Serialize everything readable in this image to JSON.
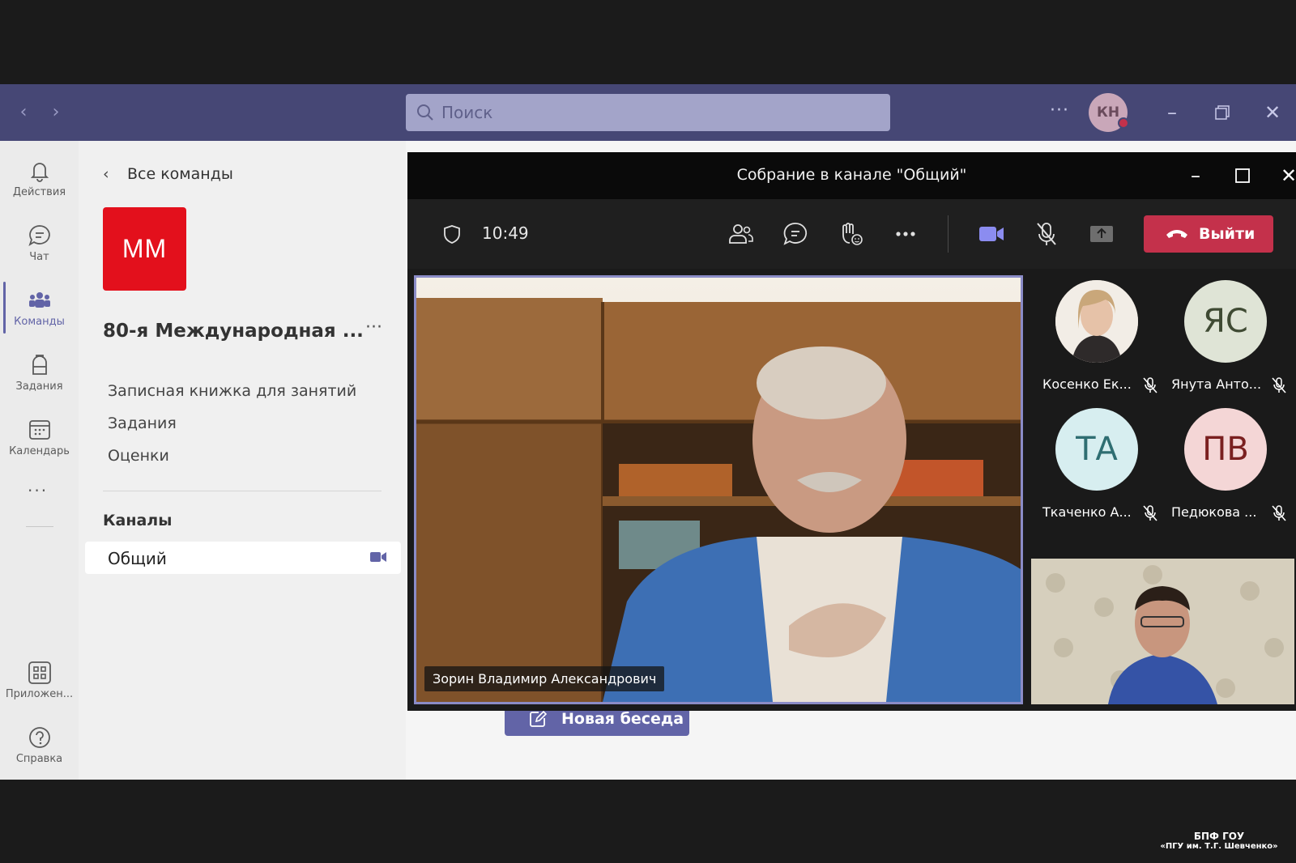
{
  "search": {
    "placeholder": "Поиск"
  },
  "titlebar": {
    "more": "···",
    "user_initials": "КН"
  },
  "rail": {
    "items": [
      {
        "label": "Действия"
      },
      {
        "label": "Чат"
      },
      {
        "label": "Команды"
      },
      {
        "label": "Задания"
      },
      {
        "label": "Календарь"
      },
      {
        "label": "Приложен..."
      },
      {
        "label": "Справка"
      }
    ],
    "more": "···"
  },
  "team_panel": {
    "back_label": "Все команды",
    "logo_text": "ММ",
    "team_name": "80-я Международная ...",
    "more": "···",
    "tabs": [
      {
        "label": "Записная книжка для занятий"
      },
      {
        "label": "Задания"
      },
      {
        "label": "Оценки"
      }
    ],
    "channels_header": "Каналы",
    "channels": [
      {
        "label": "Общий"
      }
    ]
  },
  "main": {
    "new_chat_label": "Новая беседа"
  },
  "meeting": {
    "title": "Собрание в канале \"Общий\"",
    "timer": "10:49",
    "leave_label": "Выйти",
    "presenter_name": "Зорин Владимир Александрович",
    "participants": [
      {
        "name": "Косенко Ек...",
        "initials": "",
        "bg": "#e8d8c8",
        "fg": "#333333"
      },
      {
        "name": "Янута Анто...",
        "initials": "ЯС",
        "bg": "#dfe4d6",
        "fg": "#3f4a33"
      },
      {
        "name": "Ткаченко А...",
        "initials": "ТА",
        "bg": "#d7eef0",
        "fg": "#2f6e72"
      },
      {
        "name": "Педюкова ...",
        "initials": "ПВ",
        "bg": "#f4d6d6",
        "fg": "#7a2020"
      }
    ]
  },
  "watermark": {
    "line1": "БПФ ГОУ",
    "line2": "«ПГУ им. Т.Г. Шевченко»"
  },
  "colors": {
    "teams_purple": "#464775",
    "accent": "#6264a7",
    "leave_red": "#c4314b",
    "logo_red": "#e3101c"
  }
}
